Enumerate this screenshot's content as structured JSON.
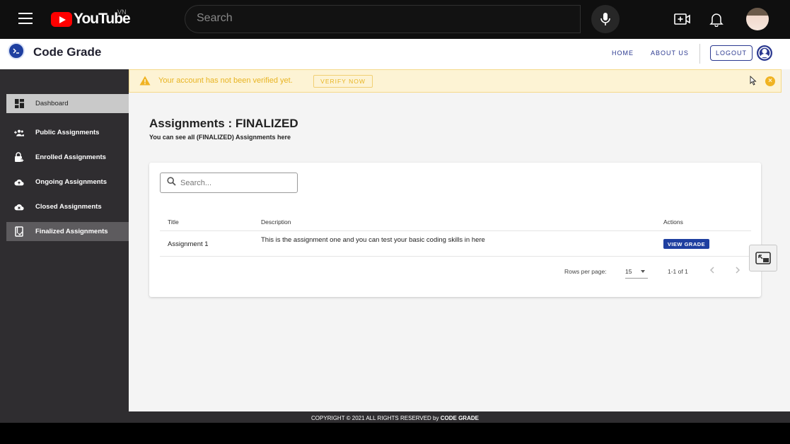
{
  "youtube": {
    "logo_text": "YouTube",
    "country": "VN",
    "search_placeholder": "Search"
  },
  "header": {
    "app_title": "Code Grade",
    "nav": [
      "HOME",
      "ABOUT US"
    ],
    "logout_label": "LOGOUT"
  },
  "sidebar": {
    "items": [
      {
        "label": "Dashboard",
        "icon": "dashboard-icon"
      },
      {
        "label": "Public Assignments",
        "icon": "group-add-icon"
      },
      {
        "label": "Enrolled Assignments",
        "icon": "lock-plus-icon"
      },
      {
        "label": "Ongoing Assignments",
        "icon": "cloud-upload-icon"
      },
      {
        "label": "Closed Assignments",
        "icon": "cloud-off-icon"
      },
      {
        "label": "Finalized Assignments",
        "icon": "finalized-icon"
      }
    ]
  },
  "alert": {
    "message": "Your account has not been verified yet.",
    "verify_label": "VERIFY NOW"
  },
  "main": {
    "title": "Assignments : FINALIZED",
    "subtitle": "You can see all (FINALIZED) Assignments here",
    "search_placeholder": "Search...",
    "table": {
      "headers": [
        "Title",
        "Description",
        "Actions"
      ],
      "rows": [
        {
          "title": "Assignment 1",
          "description": "This is the assignment one and you can test your basic coding skills in here",
          "action": "VIEW GRADE"
        }
      ]
    },
    "pagination": {
      "rows_per_page_label": "Rows per page:",
      "rows_per_page": "15",
      "range": "1-1 of 1"
    }
  },
  "footer": {
    "text": "COPYRIGHT © 2021 ALL RIGHTS RESERVED by",
    "brand": "CODE GRADE"
  },
  "colors": {
    "brand_blue": "#1e3fa0",
    "sidebar_bg": "#2f2d30",
    "warning": "#e8b422"
  }
}
